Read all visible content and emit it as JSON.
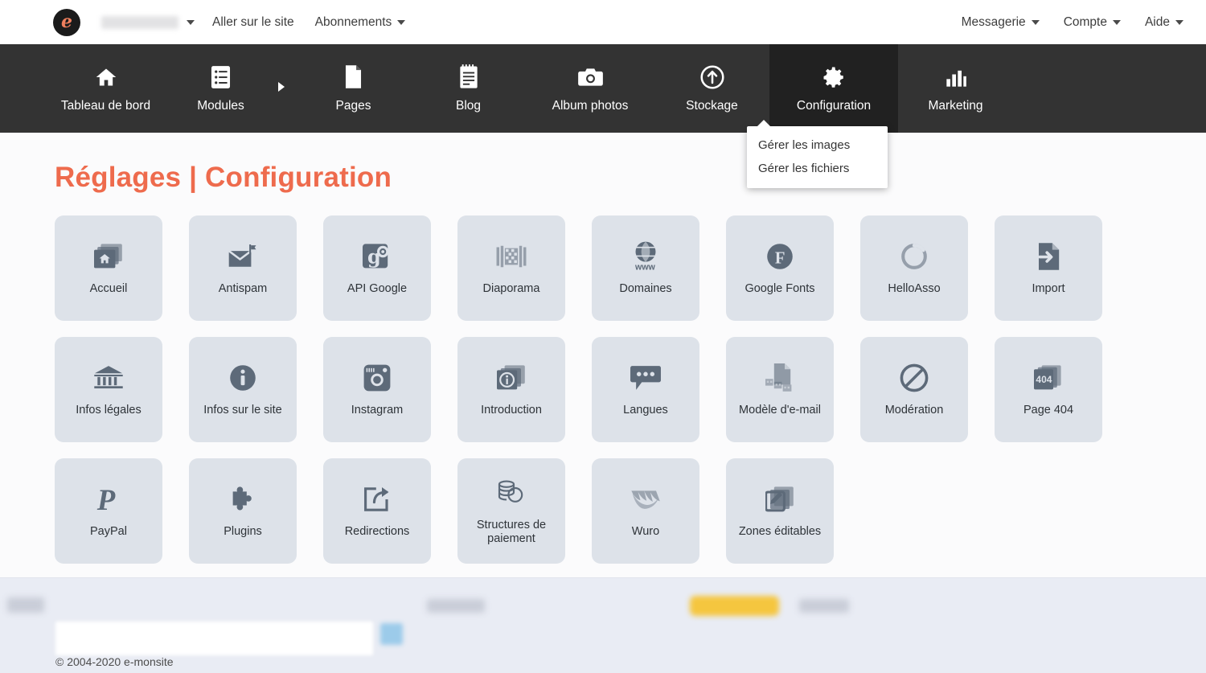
{
  "topbar": {
    "logo_glyph": "e",
    "logo_icon": "e-monsite-logo-icon",
    "site_name_redacted": "",
    "links": [
      {
        "label": "Aller sur le site",
        "caret": false
      },
      {
        "label": "Abonnements",
        "caret": true
      }
    ],
    "right_links": [
      {
        "label": "Messagerie",
        "caret": true
      },
      {
        "label": "Compte",
        "caret": true
      },
      {
        "label": "Aide",
        "caret": true
      }
    ]
  },
  "mainnav": {
    "items": [
      {
        "label": "Tableau de bord",
        "icon": "home-icon",
        "active": false,
        "sub_arrow": false
      },
      {
        "label": "Modules",
        "icon": "list-icon",
        "active": false,
        "sub_arrow": true
      },
      {
        "label": "Pages",
        "icon": "page-icon",
        "active": false,
        "sub_arrow": false
      },
      {
        "label": "Blog",
        "icon": "notebook-icon",
        "active": false,
        "sub_arrow": false
      },
      {
        "label": "Album photos",
        "icon": "camera-icon",
        "active": false,
        "sub_arrow": false
      },
      {
        "label": "Stockage",
        "icon": "upload-circle-icon",
        "active": false,
        "sub_arrow": false
      },
      {
        "label": "Configuration",
        "icon": "gear-icon",
        "active": true,
        "sub_arrow": false
      },
      {
        "label": "Marketing",
        "icon": "bar-chart-icon",
        "active": false,
        "sub_arrow": false
      }
    ]
  },
  "dropdown": {
    "open_under": "Stockage",
    "items": [
      {
        "label": "Gérer les images"
      },
      {
        "label": "Gérer les fichiers"
      }
    ]
  },
  "page": {
    "title": "Réglages | Configuration",
    "title_color": "#ee6b4d",
    "tiles": [
      {
        "label": "Accueil",
        "icon": "home-stack-icon"
      },
      {
        "label": "Antispam",
        "icon": "envelope-flag-icon"
      },
      {
        "label": "API Google",
        "icon": "google-gear-icon"
      },
      {
        "label": "Diaporama",
        "icon": "filmstrip-icon"
      },
      {
        "label": "Domaines",
        "icon": "globe-www-icon"
      },
      {
        "label": "Google Fonts",
        "icon": "font-circle-f-icon"
      },
      {
        "label": "HelloAsso",
        "icon": "helloasso-ring-icon"
      },
      {
        "label": "Import",
        "icon": "file-import-arrow-icon"
      },
      {
        "label": "Infos légales",
        "icon": "bank-columns-icon"
      },
      {
        "label": "Infos sur le site",
        "icon": "info-circle-icon"
      },
      {
        "label": "Instagram",
        "icon": "instagram-camera-icon"
      },
      {
        "label": "Introduction",
        "icon": "info-stack-icon"
      },
      {
        "label": "Langues",
        "icon": "speech-bubble-icon"
      },
      {
        "label": "Modèle d'e-mail",
        "icon": "email-template-icon"
      },
      {
        "label": "Modération",
        "icon": "no-entry-icon"
      },
      {
        "label": "Page 404",
        "icon": "page-404-icon"
      },
      {
        "label": "PayPal",
        "icon": "paypal-icon"
      },
      {
        "label": "Plugins",
        "icon": "puzzle-piece-icon"
      },
      {
        "label": "Redirections",
        "icon": "share-arrow-icon"
      },
      {
        "label": "Structures de paiement",
        "icon": "coins-stack-icon"
      },
      {
        "label": "Wuro",
        "icon": "wuro-bird-icon"
      },
      {
        "label": "Zones éditables",
        "icon": "edit-pencil-stack-icon"
      }
    ]
  },
  "footer": {
    "copyright": "© 2004-2020 e-monsite",
    "accent_yellow": "#f5c63f",
    "accent_blue": "#9ccbea"
  }
}
